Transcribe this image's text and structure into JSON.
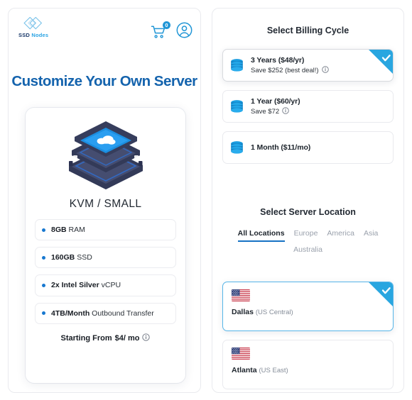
{
  "brand": {
    "logo_icon": "ssd-nodes-diamond-logo",
    "name_primary": "SSD",
    "name_secondary": "Nodes"
  },
  "header": {
    "cart_icon": "shopping-cart-icon",
    "cart_count": "0",
    "account_icon": "user-account-icon"
  },
  "left": {
    "title": "Customize Your Own Server",
    "product": {
      "illustration_icon": "isometric-server-stack-cloud-icon",
      "plan_name": "KVM / SMALL",
      "specs": [
        {
          "value": "8GB",
          "label": "RAM"
        },
        {
          "value": "160GB",
          "label": "SSD"
        },
        {
          "value": "2x Intel Silver",
          "label": "vCPU"
        },
        {
          "value": "4TB/Month",
          "label": "Outbound Transfer"
        }
      ],
      "price_prefix": "Starting From",
      "price_value": "$4/ mo",
      "price_info_icon": "info-circle-icon"
    }
  },
  "right": {
    "billing": {
      "title": "Select Billing Cycle",
      "options": [
        {
          "icon": "database-stack-icon",
          "main": "3 Years ($48/yr)",
          "sub": "Save $252 (best deal!)",
          "has_info": true,
          "info_icon": "info-circle-icon",
          "selected": true,
          "check_icon": "checkmark-icon"
        },
        {
          "icon": "database-stack-icon",
          "main": "1 Year ($60/yr)",
          "sub": "Save $72",
          "has_info": true,
          "info_icon": "info-circle-icon",
          "selected": false,
          "check_icon": "checkmark-icon"
        },
        {
          "icon": "database-stack-icon",
          "main": "1 Month ($11/mo)",
          "sub": "",
          "has_info": false,
          "info_icon": "info-circle-icon",
          "selected": false,
          "check_icon": "checkmark-icon"
        }
      ]
    },
    "location": {
      "title": "Select Server Location",
      "tabs": [
        {
          "label": "All Locations",
          "active": true
        },
        {
          "label": "Europe",
          "active": false
        },
        {
          "label": "America",
          "active": false
        },
        {
          "label": "Asia",
          "active": false
        },
        {
          "label": "Australia",
          "active": false
        }
      ],
      "cards": [
        {
          "flag_icon": "us-flag-icon",
          "city": "Dallas",
          "region": "(US Central)",
          "selected": true,
          "check_icon": "checkmark-icon"
        },
        {
          "flag_icon": "us-flag-icon",
          "city": "Atlanta",
          "region": "(US East)",
          "selected": false,
          "check_icon": "checkmark-icon"
        }
      ]
    }
  },
  "colors": {
    "brand_blue": "#29a3e3",
    "title_blue": "#1463ad",
    "accent_blue": "#2196d6",
    "tab_active": "#1672c4"
  }
}
